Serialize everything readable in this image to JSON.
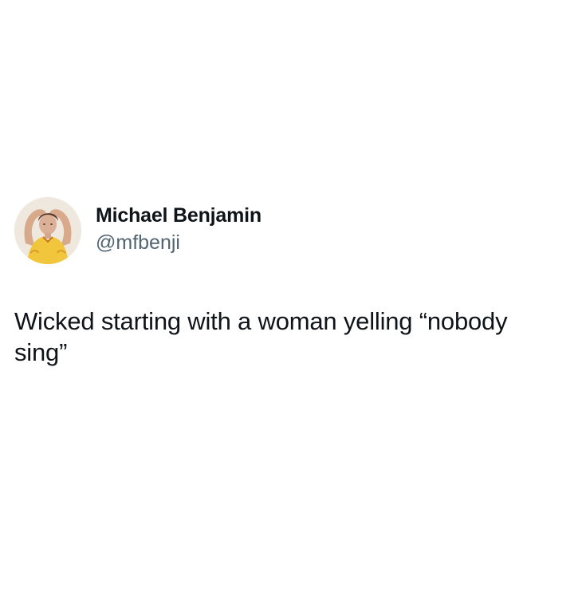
{
  "tweet": {
    "author": {
      "display_name": "Michael Benjamin",
      "handle": "@mfbenji",
      "avatar_icon": "user-avatar-photo"
    },
    "text": "Wicked starting with a woman yelling “nobody sing”"
  },
  "colors": {
    "background": "#ffffff",
    "text_primary": "#0f1419",
    "text_secondary": "#536471",
    "avatar_shirt": "#f2c63c"
  }
}
